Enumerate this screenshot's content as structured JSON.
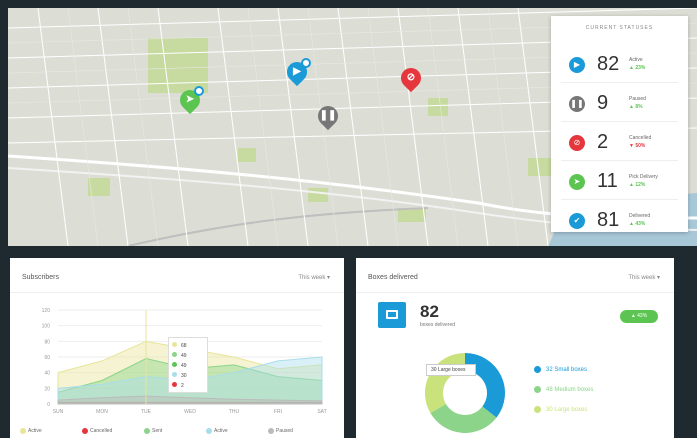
{
  "status_panel": {
    "title": "CURRENT STATUSES",
    "rows": [
      {
        "count": "82",
        "label": "Active",
        "trend": "▲ 23%",
        "color": "#1a9ad6",
        "trend_color": "#5cc552",
        "icon": "play-icon"
      },
      {
        "count": "9",
        "label": "Paused",
        "trend": "▲ 8%",
        "color": "#777777",
        "trend_color": "#5cc552",
        "icon": "pause-icon"
      },
      {
        "count": "2",
        "label": "Cancelled",
        "trend": "▼ 50%",
        "color": "#e5363e",
        "trend_color": "#e5363e",
        "icon": "cancel-icon"
      },
      {
        "count": "11",
        "label": "Pick Delivery",
        "trend": "▲ 12%",
        "color": "#5cc552",
        "trend_color": "#5cc552",
        "icon": "arrow-icon"
      },
      {
        "count": "81",
        "label": "Delivered",
        "trend": "▲ 43%",
        "color": "#1a9ad6",
        "trend_color": "#5cc552",
        "icon": "check-icon"
      }
    ]
  },
  "subscribers_card": {
    "title": "Subscribers",
    "filter": "This week ▾",
    "chart_data": {
      "type": "area",
      "x": [
        "SUN",
        "MON",
        "TUE",
        "WED",
        "THU",
        "FRI",
        "SAT"
      ],
      "ylim": [
        0,
        120
      ],
      "yticks": [
        "120",
        "100",
        "80",
        "60",
        "40",
        "20",
        "0"
      ],
      "series": [
        {
          "name": "Active",
          "color": "#e8e59a",
          "values": [
            40,
            55,
            80,
            70,
            60,
            45,
            50
          ]
        },
        {
          "name": "Cancelled",
          "color": "#e5363e",
          "values": [
            2,
            2,
            2,
            2,
            2,
            2,
            2
          ]
        },
        {
          "name": "Sent",
          "color": "#8bd48a",
          "values": [
            15,
            30,
            58,
            45,
            50,
            35,
            30
          ]
        },
        {
          "name": "Active",
          "color": "#a8ddeb",
          "values": [
            20,
            25,
            35,
            30,
            40,
            55,
            60
          ]
        },
        {
          "name": "Paused",
          "color": "#bbbbbb",
          "values": [
            5,
            8,
            10,
            8,
            6,
            5,
            4
          ]
        }
      ]
    },
    "tooltip": [
      {
        "value": "68",
        "color": "#e8e59a"
      },
      {
        "value": "49",
        "color": "#8bd48a"
      },
      {
        "value": "49",
        "color": "#5cc552"
      },
      {
        "value": "30",
        "color": "#a8ddeb"
      },
      {
        "value": "2",
        "color": "#e5363e"
      }
    ],
    "legend": [
      {
        "label": "Active",
        "color": "#e8e59a"
      },
      {
        "label": "Cancelled",
        "color": "#e5363e"
      },
      {
        "label": "Sent",
        "color": "#8bd48a"
      },
      {
        "label": "Active",
        "color": "#a8ddeb"
      },
      {
        "label": "Paused",
        "color": "#bbbbbb"
      }
    ]
  },
  "boxes_card": {
    "title": "Boxes delivered",
    "filter": "This week ▾",
    "count": "82",
    "count_label": "boxes delivered",
    "badge": "▲ 43%",
    "chart_data": {
      "type": "pie",
      "slices": [
        {
          "label": "32 Small boxes",
          "value": 32,
          "color": "#1a9ad6"
        },
        {
          "label": "48 Medium boxes",
          "value": 28,
          "color": "#8bd48a"
        },
        {
          "label": "30 Large boxes",
          "value": 30,
          "color": "#c9e27c"
        }
      ]
    },
    "tip": "30 Large boxes",
    "legend": [
      {
        "label": "32 Small boxes",
        "color": "#1a9ad6"
      },
      {
        "label": "48 Medium boxes",
        "color": "#8bd48a"
      },
      {
        "label": "30 Large boxes",
        "color": "#c9e27c"
      }
    ]
  }
}
